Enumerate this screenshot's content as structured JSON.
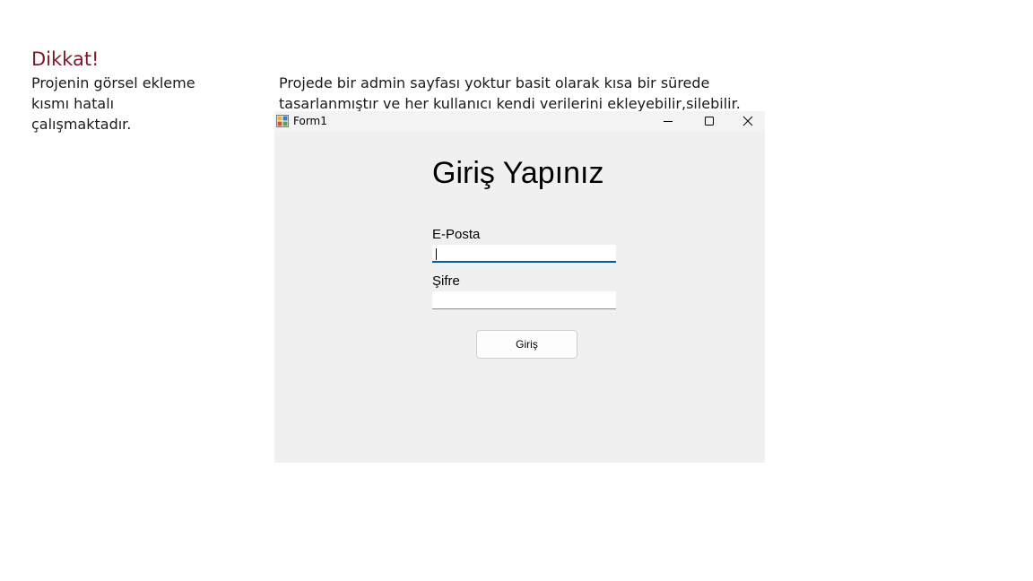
{
  "note": {
    "title": "Dikkat!",
    "body": "Projenin görsel ekleme kısmı hatalı çalışmaktadır."
  },
  "info": {
    "text": "Projede bir admin sayfası yoktur basit olarak kısa bir sürede tasarlanmıştır ve her kullanıcı kendi verilerini ekleyebilir,silebilir."
  },
  "window": {
    "title": "Form1",
    "icon": "winforms-app-icon",
    "controls": [
      "minimize-icon",
      "maximize-icon",
      "close-icon"
    ]
  },
  "form": {
    "heading": "Giriş Yapınız",
    "email_label": "E-Posta",
    "email_value": "",
    "password_label": "Şifre",
    "password_value": "",
    "submit_label": "Giriş"
  },
  "colors": {
    "warning_title": "#7b1a2a",
    "focus_underline": "#005a9e",
    "window_bg": "#f0f0f0"
  }
}
